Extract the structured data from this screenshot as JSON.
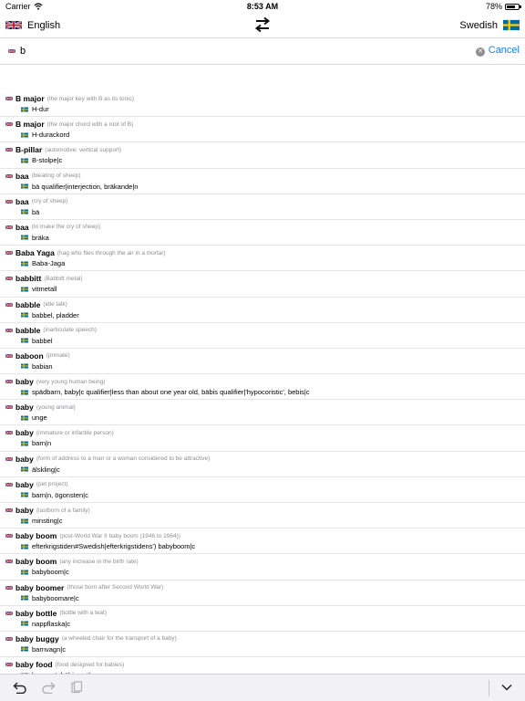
{
  "status_bar": {
    "carrier": "Carrier",
    "time": "8:53 AM",
    "battery_percent": "78%",
    "battery_level": 0.78
  },
  "header": {
    "source_language": "English",
    "target_language": "Swedish"
  },
  "search": {
    "query": "b",
    "cancel_label": "Cancel"
  },
  "colors": {
    "accent": "#1a7ef4",
    "gloss_gray": "#8e8e93",
    "toolbar_bg": "#f2f2f4"
  },
  "results": [
    {
      "term": "B major",
      "gloss": "(the major key with B as its tonic)",
      "translation": "H-dur"
    },
    {
      "term": "B major",
      "gloss": "(the major chord with a root of B)",
      "translation": "H-durackord"
    },
    {
      "term": "B-pillar",
      "gloss": "(automotive: vertical support)",
      "translation": "B-stolpe|c"
    },
    {
      "term": "baa",
      "gloss": "(bleating of sheep)",
      "translation": "bä qualifier|interjection, bräkande|n"
    },
    {
      "term": "baa",
      "gloss": "(cry of sheep)",
      "translation": "bä"
    },
    {
      "term": "baa",
      "gloss": "(to make the cry of sheep)",
      "translation": "bräka"
    },
    {
      "term": "Baba Yaga",
      "gloss": "(hag who flies through the air in a mortar)",
      "translation": "Baba-Jaga"
    },
    {
      "term": "babbitt",
      "gloss": "(Babbitt metal)",
      "translation": "vitmetall"
    },
    {
      "term": "babble",
      "gloss": "(idle talk)",
      "translation": "babbel, pladder"
    },
    {
      "term": "babble",
      "gloss": "(inarticulate speech)",
      "translation": "babbel"
    },
    {
      "term": "baboon",
      "gloss": "(primate)",
      "translation": "babian"
    },
    {
      "term": "baby",
      "gloss": "(very young human being)",
      "translation": "spädbarn, baby|c qualifier|less than about one year old, bäbis qualifier|'hypocoristic', bebis|c"
    },
    {
      "term": "baby",
      "gloss": "(young animal)",
      "translation": "unge"
    },
    {
      "term": "baby",
      "gloss": "(immature or infantile person)",
      "translation": "barn|n"
    },
    {
      "term": "baby",
      "gloss": "(form of address to a man or a woman considered to be attractive)",
      "translation": "älskling|c"
    },
    {
      "term": "baby",
      "gloss": "(pet project)",
      "translation": "barn|n, ögonsten|c"
    },
    {
      "term": "baby",
      "gloss": "(lastborn of a family)",
      "translation": "minsting|c"
    },
    {
      "term": "baby boom",
      "gloss": "(post-World War II baby boom (1946 to 1964))",
      "translation": "efterkrigstiden#Swedish|efterkrigstidens') babyboom|c"
    },
    {
      "term": "baby boom",
      "gloss": "(any increase in the birth rate)",
      "translation": "babyboom|c"
    },
    {
      "term": "baby boomer",
      "gloss": "(those born after Second World War)",
      "translation": "babyboomare|c"
    },
    {
      "term": "baby bottle",
      "gloss": "(bottle with a teat)",
      "translation": "nappflaska|c"
    },
    {
      "term": "baby buggy",
      "gloss": "(a wheeled chair for the transport of a baby)",
      "translation": "barnvagn|c"
    },
    {
      "term": "baby food",
      "gloss": "(food designed for babies)",
      "translation": "barnmat, bäbismat|c"
    }
  ]
}
